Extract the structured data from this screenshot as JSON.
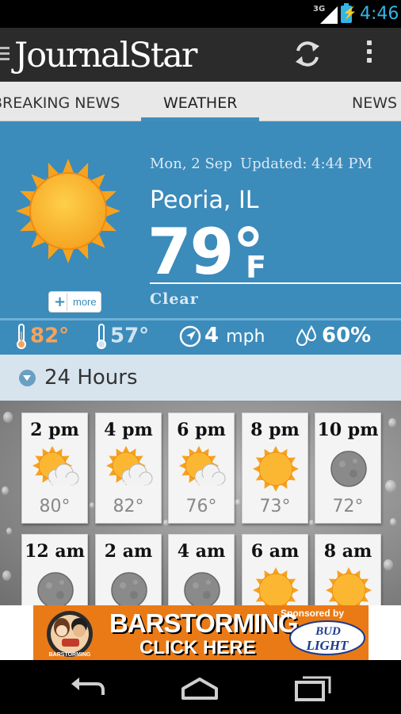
{
  "status_bar": {
    "network": "3G",
    "time": "4:46",
    "accent_color": "#33b5e5"
  },
  "action_bar": {
    "logo_text": "JournalStar",
    "icons": [
      "navigation-up-icon",
      "refresh-icon",
      "overflow-menu-icon"
    ]
  },
  "tabs": [
    {
      "label": "BREAKING NEWS",
      "active": false
    },
    {
      "label": "WEATHER",
      "active": true
    },
    {
      "label": "NEWS",
      "active": false
    }
  ],
  "current": {
    "date": "Mon, 2 Sep",
    "updated": "Updated: 4:44 PM",
    "location": "Peoria, IL",
    "temperature": "79°",
    "unit": "F",
    "condition": "Clear",
    "more_label": "more",
    "icon": "sunny-icon",
    "background_color": "#3b8bbb"
  },
  "stats": {
    "high": "82°",
    "low": "57°",
    "wind_value": "4",
    "wind_unit": "mph",
    "humidity": "60%"
  },
  "hourly": {
    "title": "24 Hours",
    "items": [
      {
        "time": "2 pm",
        "icon": "partly-cloudy-icon",
        "temp": "80°"
      },
      {
        "time": "4 pm",
        "icon": "partly-cloudy-icon",
        "temp": "82°"
      },
      {
        "time": "6 pm",
        "icon": "partly-cloudy-icon",
        "temp": "76°"
      },
      {
        "time": "8 pm",
        "icon": "sunny-icon",
        "temp": "73°"
      },
      {
        "time": "10 pm",
        "icon": "moon-icon",
        "temp": "72°"
      },
      {
        "time": "12 am",
        "icon": "moon-icon",
        "temp": ""
      },
      {
        "time": "2 am",
        "icon": "moon-icon",
        "temp": ""
      },
      {
        "time": "4 am",
        "icon": "moon-icon",
        "temp": ""
      },
      {
        "time": "6 am",
        "icon": "sunny-icon",
        "temp": ""
      },
      {
        "time": "8 am",
        "icon": "sunny-icon",
        "temp": ""
      }
    ]
  },
  "ad": {
    "headline": "BARSTORMING",
    "cta": "CLICK HERE",
    "sponsor": "Sponsored by",
    "sponsor_brand_line1": "BUD",
    "sponsor_brand_line2": "LIGHT",
    "badge_text": "BARSTORMING",
    "background_color": "#ea7a16"
  },
  "nav_bar": {
    "icons": [
      "back-icon",
      "home-icon",
      "recent-apps-icon"
    ]
  }
}
